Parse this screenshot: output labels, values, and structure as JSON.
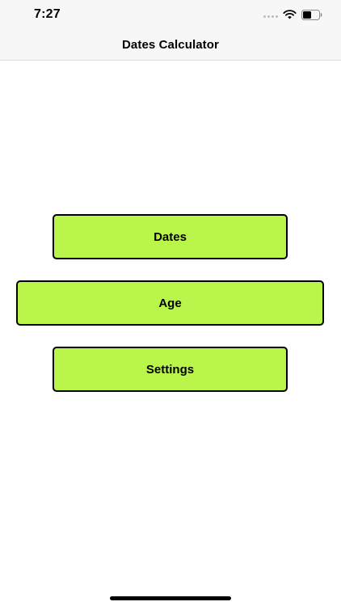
{
  "status_bar": {
    "time": "7:27",
    "icons": [
      "signal-dots-icon",
      "wifi-icon",
      "battery-icon"
    ]
  },
  "nav": {
    "title": "Dates Calculator"
  },
  "menu": {
    "buttons": [
      {
        "label": "Dates"
      },
      {
        "label": "Age"
      },
      {
        "label": "Settings"
      }
    ]
  },
  "colors": {
    "button_fill": "#b9f54b",
    "button_border": "#000000",
    "bar_background": "#f7f7f7"
  }
}
